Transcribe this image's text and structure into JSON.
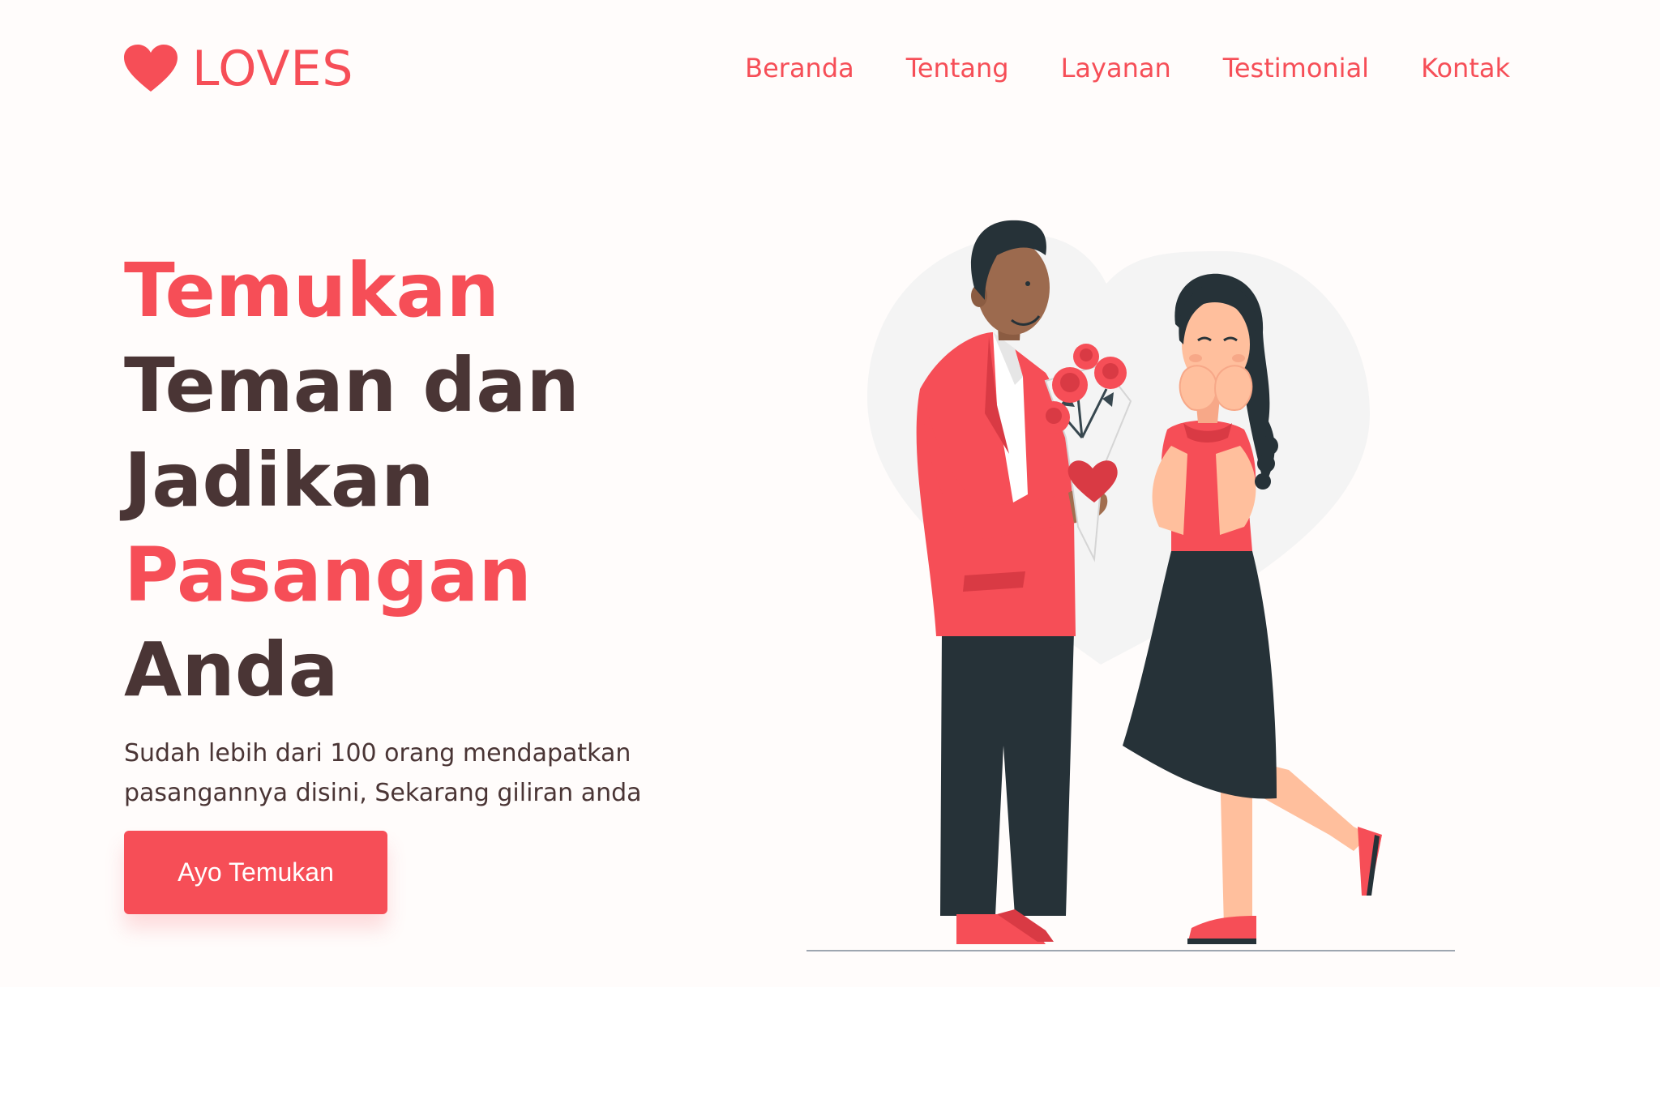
{
  "colors": {
    "accent": "#f64e57",
    "heading_dark": "#4a3535",
    "hero_background": "#fffcfb"
  },
  "brand": {
    "icon": "heart-icon",
    "name": "LOVES"
  },
  "nav": {
    "items": [
      {
        "label": "Beranda"
      },
      {
        "label": "Tentang"
      },
      {
        "label": "Layanan"
      },
      {
        "label": "Testimonial"
      },
      {
        "label": "Kontak"
      }
    ]
  },
  "hero": {
    "headline": {
      "line1": "Temukan",
      "line2": "Teman dan",
      "line3": "Jadikan",
      "line4": "Pasangan",
      "line5": "Anda"
    },
    "subtitle": "Sudah lebih dari 100 orang mendapatkan pasangannya disini, Sekarang giliran anda",
    "cta_label": "Ayo Temukan",
    "illustration": "couple-with-flowers-illustration"
  }
}
